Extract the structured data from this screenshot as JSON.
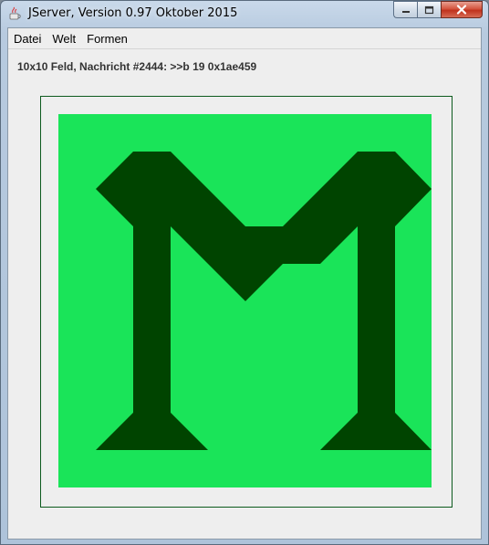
{
  "window": {
    "title": "JServer, Version 0.97 Oktober 2015",
    "app_icon": "java-cup-icon",
    "controls": [
      "minimize-icon",
      "maximize-icon",
      "close-icon"
    ]
  },
  "menu": {
    "items": [
      "Datei",
      "Welt",
      "Formen"
    ]
  },
  "status": {
    "text": "10x10 Feld, Nachricht #2444: >>b 19 0x1ae459"
  },
  "board": {
    "grid": "10x10",
    "background_color": "#1ae459",
    "shape_color": "#004400",
    "frame_color": "#0d5a1e"
  }
}
